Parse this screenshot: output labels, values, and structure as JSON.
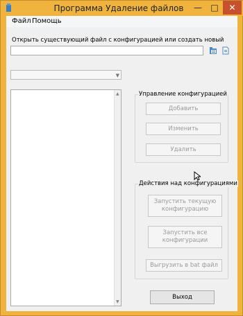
{
  "window": {
    "title": "Программа Удаление файлов",
    "min_label": "—",
    "max_label": "□",
    "close_label": "✕"
  },
  "menu": {
    "file": "Файл",
    "help": "Помощь"
  },
  "config_file": {
    "label": "Открыть существующий файл с конфигурацией или создать новый",
    "value": "",
    "open_icon": "open-folder-icon",
    "new_icon": "new-file-icon"
  },
  "config_select": {
    "value": ""
  },
  "manage_group": {
    "title": "Управление конфигурацией",
    "add": "Добавить",
    "edit": "Изменить",
    "delete": "Удалить"
  },
  "actions_group": {
    "title": "Действия над конфигурациями",
    "run_current": "Запустить текущую конфигурацию",
    "run_all": "Запустить все конфигурации",
    "export_bat": "Выгрузить в bat файл"
  },
  "exit_label": "Выход",
  "colors": {
    "title_bar": "#f0b43e",
    "close_button": "#c7502f",
    "client_bg": "#f0f0f0"
  }
}
